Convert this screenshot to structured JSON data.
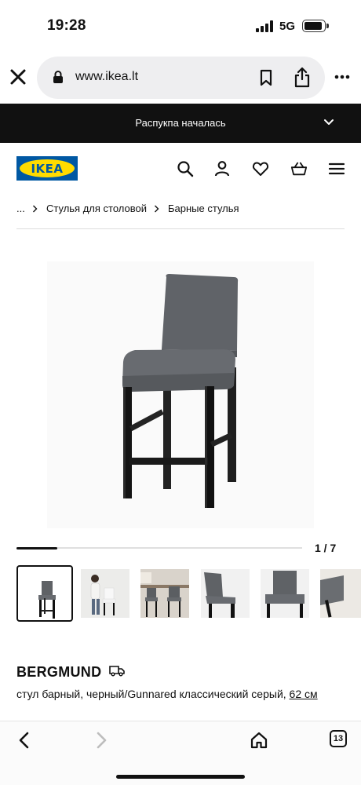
{
  "status_bar": {
    "time": "19:28",
    "network": "5G"
  },
  "browser": {
    "url": "www.ikea.lt",
    "tab_count": "13"
  },
  "promo": {
    "text": "Распукпа началась"
  },
  "header": {
    "logo_text": "IKEA"
  },
  "breadcrumb": {
    "ellipsis": "...",
    "items": [
      "Стулья для столовой",
      "Барные стулья"
    ]
  },
  "gallery": {
    "counter": "1 / 7",
    "current_image": 1,
    "total_images": 7
  },
  "product": {
    "name": "BERGMUND",
    "description": "стул барный, черный/Gunnared классический серый,",
    "size": "62 см"
  },
  "colors": {
    "promo_bg": "#111111",
    "ikea_blue": "#0058a3",
    "ikea_yellow": "#ffdb00",
    "fabric_grey": "#5f6266",
    "leg_black": "#1b1b1b"
  }
}
